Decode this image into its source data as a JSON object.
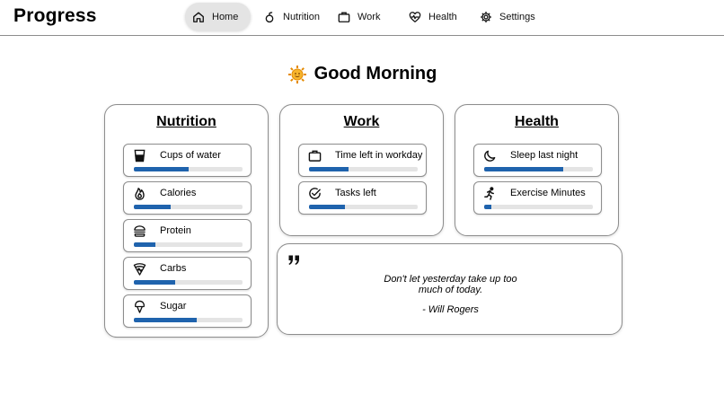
{
  "header": {
    "brand": "Progress",
    "nav": [
      {
        "label": "Home",
        "icon": "home-icon",
        "active": true
      },
      {
        "label": "Nutrition",
        "icon": "fruit-icon",
        "active": false
      },
      {
        "label": "Work",
        "icon": "briefcase-icon",
        "active": false
      },
      {
        "label": "Health",
        "icon": "heart-pulse-icon",
        "active": false
      },
      {
        "label": "Settings",
        "icon": "gear-icon",
        "active": false
      }
    ]
  },
  "greeting": {
    "icon": "sun-icon",
    "text": "Good Morning"
  },
  "cards": {
    "nutrition": {
      "title": "Nutrition",
      "metrics": [
        {
          "label": "Cups of water",
          "icon": "water-glass-icon",
          "progress": 0.5
        },
        {
          "label": "Calories",
          "icon": "flame-icon",
          "progress": 0.34
        },
        {
          "label": "Protein",
          "icon": "burger-icon",
          "progress": 0.2
        },
        {
          "label": "Carbs",
          "icon": "pizza-icon",
          "progress": 0.38
        },
        {
          "label": "Sugar",
          "icon": "ice-cream-icon",
          "progress": 0.58
        }
      ]
    },
    "work": {
      "title": "Work",
      "metrics": [
        {
          "label": "Time left in workday",
          "icon": "briefcase-icon",
          "progress": 0.36
        },
        {
          "label": "Tasks left",
          "icon": "check-circle-icon",
          "progress": 0.33
        }
      ]
    },
    "health": {
      "title": "Health",
      "metrics": [
        {
          "label": "Sleep last night",
          "icon": "moon-icon",
          "progress": 0.73
        },
        {
          "label": "Exercise Minutes",
          "icon": "running-icon",
          "progress": 0.07
        }
      ]
    }
  },
  "quote": {
    "icon": "quote-icon",
    "text": "Don't let yesterday take up too much of today.",
    "author": "- Will Rogers"
  },
  "colors": {
    "accent": "#1f63ad",
    "track": "#e4e4e4",
    "border": "#8d8d8d",
    "active_nav": "#e4e4e4"
  }
}
